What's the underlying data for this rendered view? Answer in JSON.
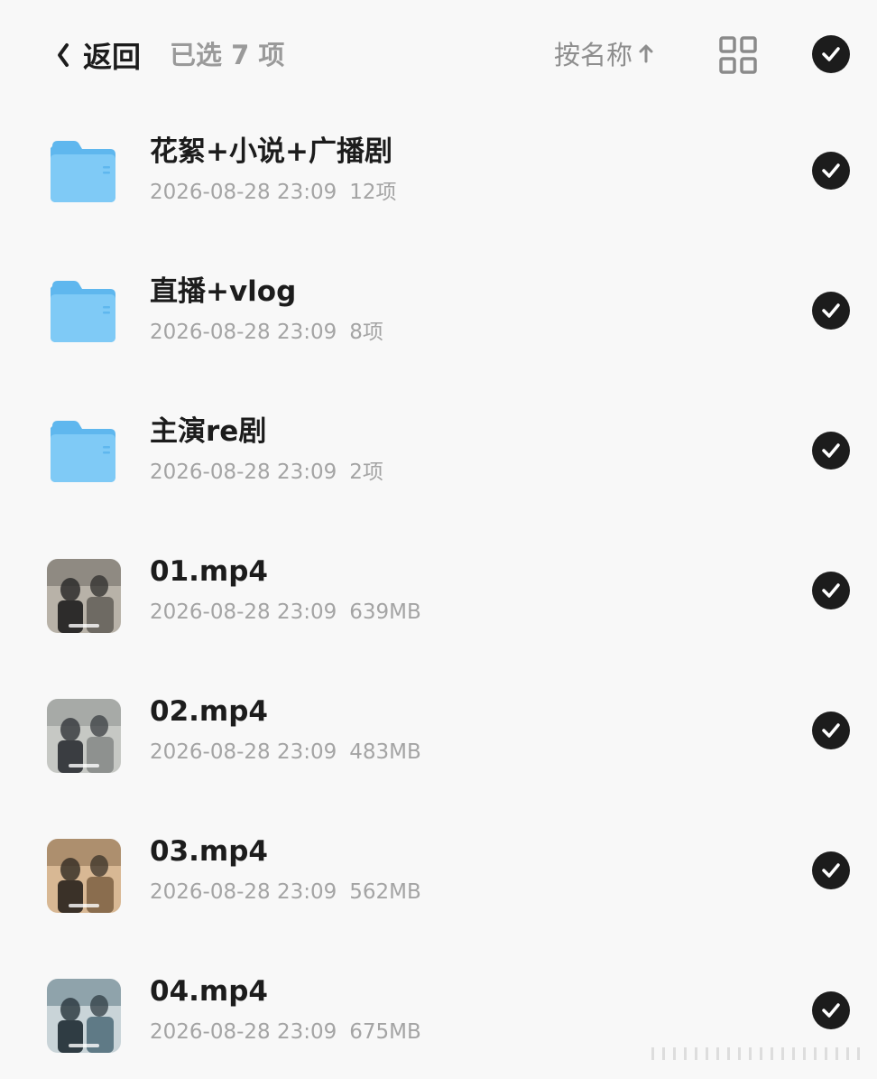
{
  "header": {
    "back_label": "返回",
    "selected_text": "已选 7 项",
    "sort_label": "按名称",
    "sort_direction_icon": "arrow-up-icon",
    "view_toggle_icon": "grid-view-icon",
    "select_all_icon": "check-circle-icon"
  },
  "colors": {
    "accent": "#1c1c1c",
    "folder": "#6cc0f2",
    "muted_text": "#a4a4a4",
    "background": "#f8f8f8"
  },
  "items": [
    {
      "type": "folder",
      "name": "花絮+小说+广播剧",
      "date": "2026-08-28 23:09",
      "info": "12项",
      "selected": true
    },
    {
      "type": "folder",
      "name": "直播+vlog",
      "date": "2026-08-28 23:09",
      "info": "8项",
      "selected": true
    },
    {
      "type": "folder",
      "name": "主演re剧",
      "date": "2026-08-28 23:09",
      "info": "2项",
      "selected": true
    },
    {
      "type": "video",
      "name": "01.mp4",
      "date": "2026-08-28 23:09",
      "info": "639MB",
      "selected": true
    },
    {
      "type": "video",
      "name": "02.mp4",
      "date": "2026-08-28 23:09",
      "info": "483MB",
      "selected": true
    },
    {
      "type": "video",
      "name": "03.mp4",
      "date": "2026-08-28 23:09",
      "info": "562MB",
      "selected": true
    },
    {
      "type": "video",
      "name": "04.mp4",
      "date": "2026-08-28 23:09",
      "info": "675MB",
      "selected": true
    }
  ]
}
